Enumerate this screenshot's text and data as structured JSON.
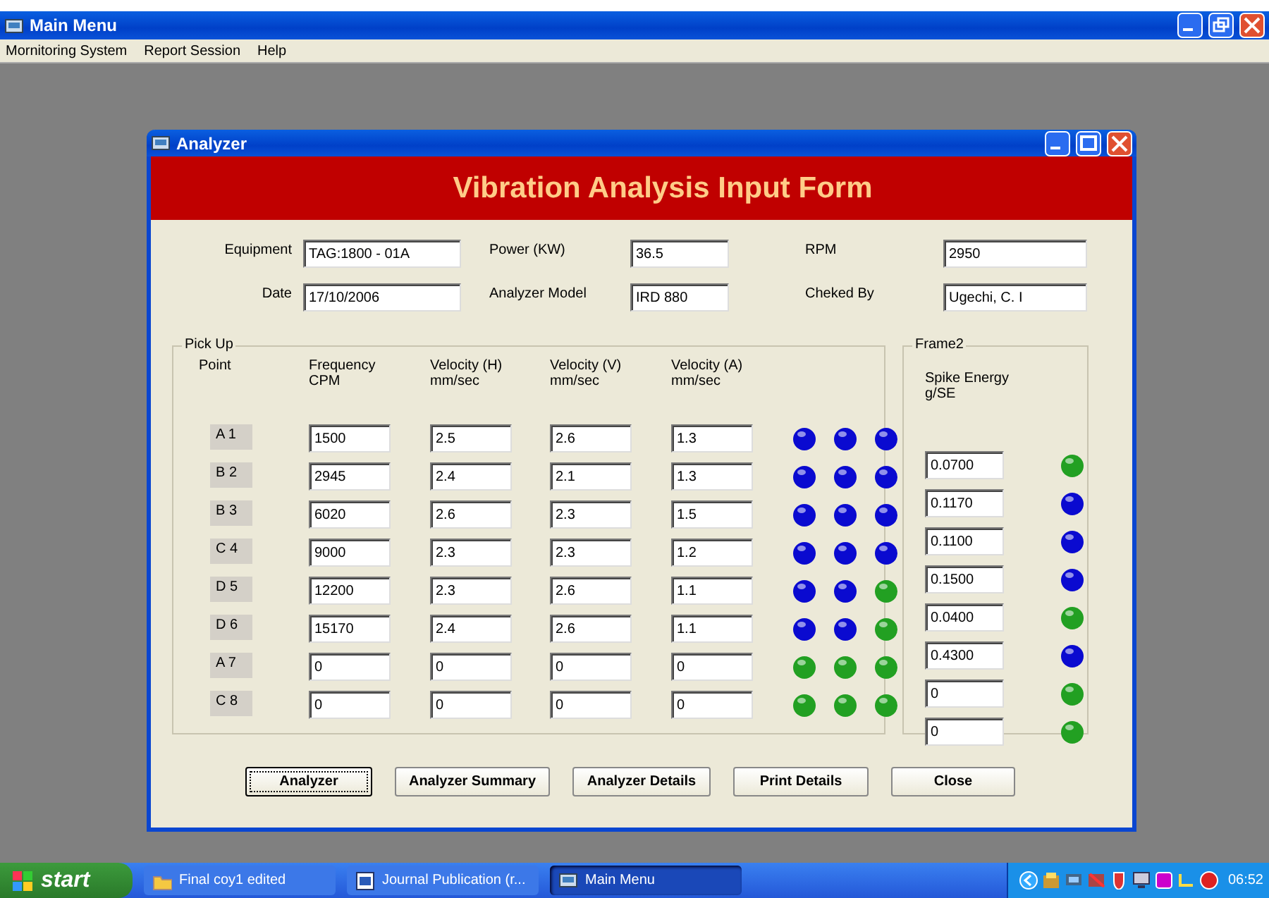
{
  "main_window": {
    "title": "Main Menu",
    "menu": [
      "Mornitoring System",
      "Report Session",
      "Help"
    ]
  },
  "analyzer_window": {
    "title": "Analyzer",
    "banner": "Vibration Analysis Input Form",
    "fields": [
      {
        "label": "Equipment",
        "value": "TAG:1800 - 01A"
      },
      {
        "label": "Power (KW)",
        "value": "36.5"
      },
      {
        "label": "RPM",
        "value": "2950"
      },
      {
        "label": "Date",
        "value": "17/10/2006"
      },
      {
        "label": "Analyzer Model",
        "value": "IRD 880"
      },
      {
        "label": "Cheked By",
        "value": "Ugechi, C. I"
      }
    ],
    "pickup": {
      "title": "Pick Up",
      "columns": [
        "Point",
        "Frequency\nCPM",
        "Velocity (H)\nmm/sec",
        "Velocity (V)\nmm/sec",
        "Velocity (A)\nmm/sec"
      ],
      "rows": [
        {
          "point": "A 1",
          "values": [
            "1500",
            "2.5",
            "2.6",
            "1.3"
          ],
          "lights": [
            {
              "color": "#0a0ad0"
            },
            {
              "color": "#0a0ad0"
            },
            {
              "color": "#0a0ad0"
            }
          ]
        },
        {
          "point": "B 2",
          "values": [
            "2945",
            "2.4",
            "2.1",
            "1.3"
          ],
          "lights": [
            {
              "color": "#0a0ad0"
            },
            {
              "color": "#0a0ad0"
            },
            {
              "color": "#0a0ad0"
            }
          ]
        },
        {
          "point": "B 3",
          "values": [
            "6020",
            "2.6",
            "2.3",
            "1.5"
          ],
          "lights": [
            {
              "color": "#0a0ad0"
            },
            {
              "color": "#0a0ad0"
            },
            {
              "color": "#0a0ad0"
            }
          ]
        },
        {
          "point": "C 4",
          "values": [
            "9000",
            "2.3",
            "2.3",
            "1.2"
          ],
          "lights": [
            {
              "color": "#0a0ad0"
            },
            {
              "color": "#0a0ad0"
            },
            {
              "color": "#0a0ad0"
            }
          ]
        },
        {
          "point": "D 5",
          "values": [
            "12200",
            "2.3",
            "2.6",
            "1.1"
          ],
          "lights": [
            {
              "color": "#0a0ad0"
            },
            {
              "color": "#0a0ad0"
            },
            {
              "color": "#22a022"
            }
          ]
        },
        {
          "point": "D 6",
          "values": [
            "15170",
            "2.4",
            "2.6",
            "1.1"
          ],
          "lights": [
            {
              "color": "#0a0ad0"
            },
            {
              "color": "#0a0ad0"
            },
            {
              "color": "#22a022"
            }
          ]
        },
        {
          "point": "A 7",
          "values": [
            "0",
            "0",
            "0",
            "0"
          ],
          "lights": [
            {
              "color": "#22a022"
            },
            {
              "color": "#22a022"
            },
            {
              "color": "#22a022"
            }
          ]
        },
        {
          "point": "C 8",
          "values": [
            "0",
            "0",
            "0",
            "0"
          ],
          "lights": [
            {
              "color": "#22a022"
            },
            {
              "color": "#22a022"
            },
            {
              "color": "#22a022"
            }
          ]
        }
      ]
    },
    "frame2": {
      "title": "Frame2",
      "column": "Spike Energy\ng/SE",
      "rows": [
        {
          "value": "0.0700",
          "color": "#22a022"
        },
        {
          "value": "0.1170",
          "color": "#0a0ad0"
        },
        {
          "value": "0.1100",
          "color": "#0a0ad0"
        },
        {
          "value": "0.1500",
          "color": "#0a0ad0"
        },
        {
          "value": "0.0400",
          "color": "#22a022"
        },
        {
          "value": "0.4300",
          "color": "#0a0ad0"
        },
        {
          "value": "0",
          "color": "#22a022"
        },
        {
          "value": "0",
          "color": "#22a022"
        }
      ]
    },
    "buttons": [
      {
        "label": "Analyzer",
        "selected": true
      },
      {
        "label": "Analyzer Summary",
        "selected": false
      },
      {
        "label": "Analyzer Details",
        "selected": false
      },
      {
        "label": "Print Details",
        "selected": false
      },
      {
        "label": "Close",
        "selected": false
      }
    ]
  },
  "taskbar": {
    "start": "start",
    "tasks": [
      {
        "label": "Final coy1 edited",
        "kind": "folder",
        "selected": false
      },
      {
        "label": "Journal Publication (r...",
        "kind": "document",
        "selected": false
      },
      {
        "label": "Main Menu",
        "kind": "app",
        "selected": true
      }
    ],
    "clock": "06:52"
  }
}
